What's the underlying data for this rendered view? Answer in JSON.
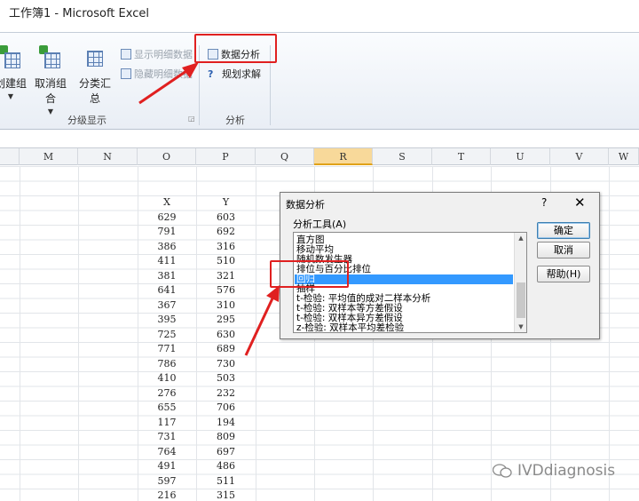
{
  "window": {
    "title": "工作簿1 - Microsoft Excel"
  },
  "ribbon": {
    "outline_group": {
      "create_group": "创建组",
      "ungroup": "取消组合",
      "subtotal": "分类汇总",
      "show_detail": "显示明细数据",
      "hide_detail": "隐藏明细数据",
      "label": "分级显示"
    },
    "analysis_group": {
      "data_analysis": "数据分析",
      "solver": "规划求解",
      "label": "分析"
    }
  },
  "sheet": {
    "columns": [
      "M",
      "N",
      "O",
      "P",
      "Q",
      "R",
      "S",
      "T",
      "U",
      "V",
      "W"
    ],
    "active_column": "R",
    "headers": {
      "x": "X",
      "y": "Y"
    },
    "x_values": [
      "629",
      "791",
      "386",
      "411",
      "381",
      "641",
      "367",
      "395",
      "725",
      "771",
      "786",
      "410",
      "276",
      "655",
      "117",
      "731",
      "764",
      "491",
      "597",
      "216"
    ],
    "y_values": [
      "603",
      "692",
      "316",
      "510",
      "321",
      "576",
      "310",
      "295",
      "630",
      "689",
      "730",
      "503",
      "232",
      "706",
      "194",
      "809",
      "697",
      "486",
      "511",
      "315"
    ]
  },
  "dialog": {
    "title": "数据分析",
    "help_glyph": "?",
    "close_glyph": "✕",
    "tools_label": "分析工具(A)",
    "tools": [
      "直方图",
      "移动平均",
      "随机数发生器",
      "排位与百分比排位",
      "回归",
      "抽样",
      "t-检验: 平均值的成对二样本分析",
      "t-检验: 双样本等方差假设",
      "t-检验: 双样本异方差假设",
      "z-检验: 双样本平均差检验"
    ],
    "selected_tool": "回归",
    "ok": "确定",
    "cancel": "取消",
    "help": "帮助(H)"
  },
  "watermark": {
    "text": "IVDdiagnosis"
  },
  "colors": {
    "annotation": "#e02020",
    "selection": "#3399ff",
    "active_column": "#f8d99a"
  }
}
